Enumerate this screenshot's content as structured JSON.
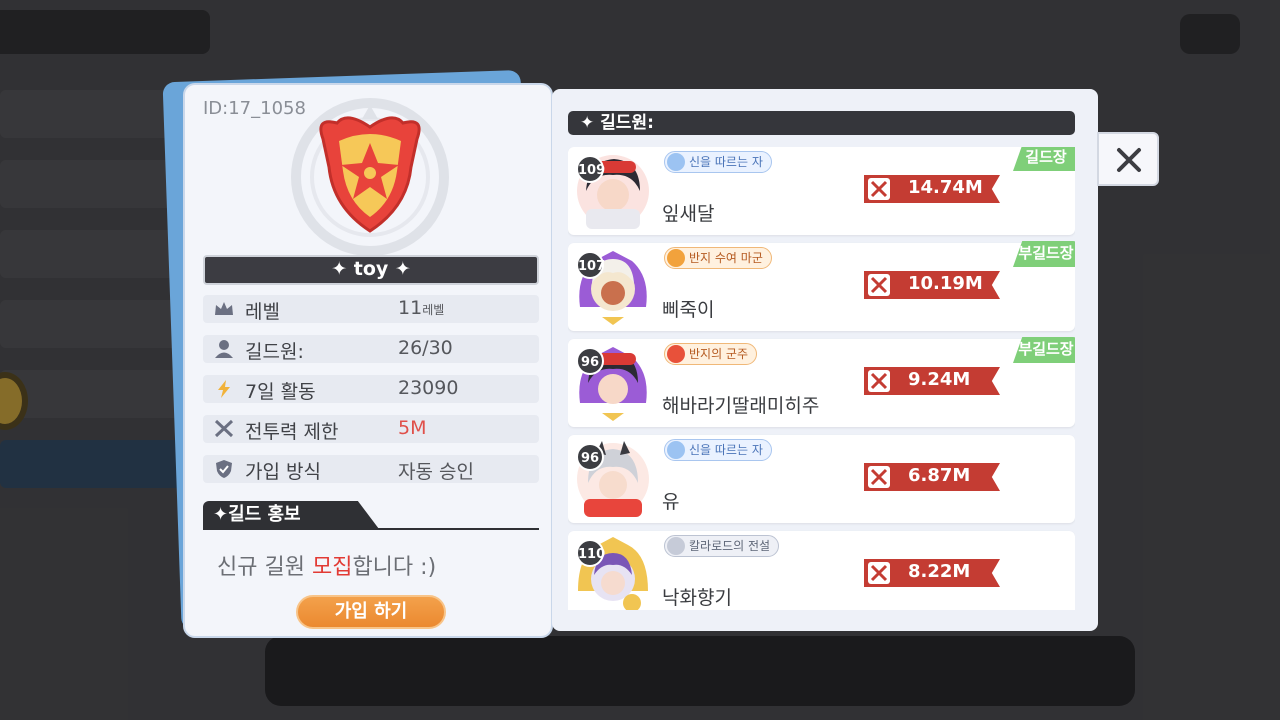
{
  "guild": {
    "id_text": "ID:17_1058",
    "name": "✦ toy ✦",
    "info": [
      {
        "icon": "crown-icon",
        "label": "레벨",
        "value": "11",
        "unit": "레벨"
      },
      {
        "icon": "person-icon",
        "label": "길드원:",
        "value": "26/30"
      },
      {
        "icon": "lightning-icon",
        "label": "7일 활동",
        "value": "23090"
      },
      {
        "icon": "crossed-swords-icon",
        "label": "전투력 제한",
        "value": "5M",
        "value_color": "#e0504a"
      },
      {
        "icon": "shield-check-icon",
        "label": "가입 방식",
        "value": "자동 승인"
      }
    ],
    "promo_tab": "✦길드 홍보",
    "promo_pre": "신규 길원 ",
    "promo_highlight": "모집",
    "promo_post": "합니다 :)",
    "join_button": "가입 하기"
  },
  "members_panel": {
    "header": "✦ 길드원:",
    "members": [
      {
        "level": "109",
        "title": "신을 따르는 자",
        "title_style": "blue",
        "name": "잎새달",
        "power": "14.74M",
        "rank": "길드장"
      },
      {
        "level": "107",
        "title": "반지 수여 마군",
        "title_style": "gold",
        "name": "삐죽이",
        "power": "10.19M",
        "rank": "부길드장"
      },
      {
        "level": "96",
        "title": "반지의 군주",
        "title_style": "gold",
        "name": "해바라기딸래미히주",
        "power": "9.24M",
        "rank": "부길드장"
      },
      {
        "level": "96",
        "title": "신을 따르는 자",
        "title_style": "blue",
        "name": "유",
        "power": "6.87M",
        "rank": ""
      },
      {
        "level": "110",
        "title": "칼라로드의 전설",
        "title_style": "silver",
        "name": "낙화향기",
        "power": "8.22M",
        "rank": ""
      }
    ]
  },
  "colors": {
    "accent_orange": "#eb8930",
    "power_red": "#c43c33",
    "rank_green": "#7fcf79",
    "dark_header": "#35363b"
  }
}
